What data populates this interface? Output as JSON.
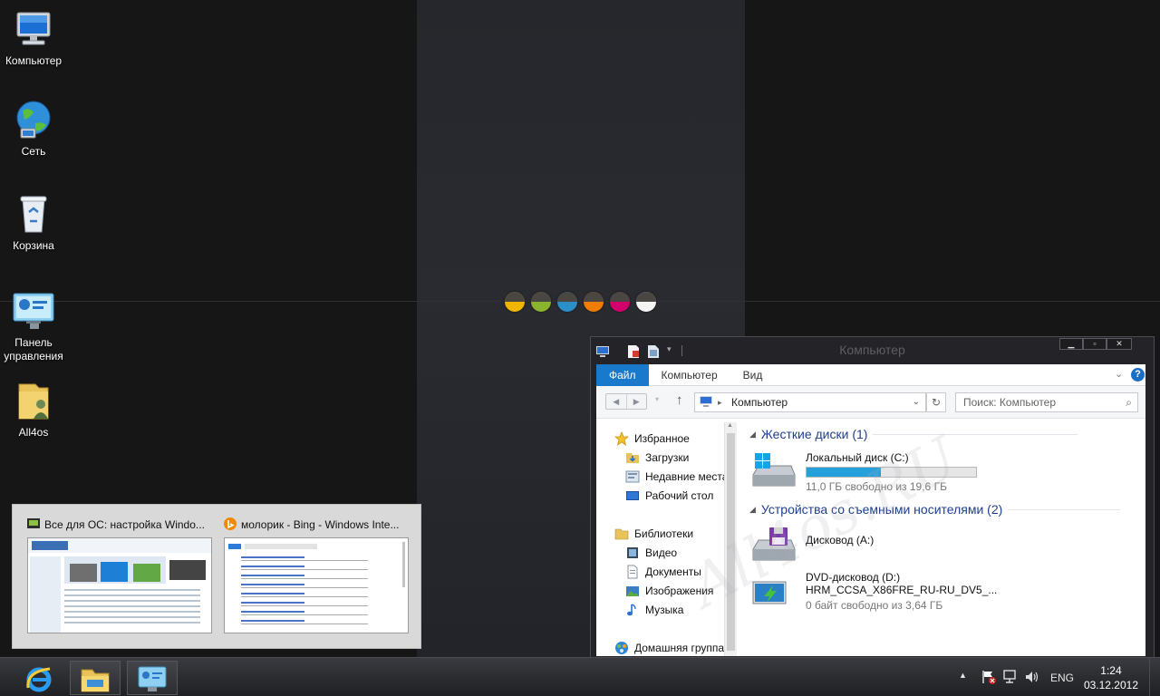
{
  "desktop": {
    "icons": [
      {
        "label": "Компьютер",
        "icon": "computer-icon"
      },
      {
        "label": "Сеть",
        "icon": "network-globe-icon"
      },
      {
        "label": "Корзина",
        "icon": "recycle-bin-icon"
      },
      {
        "label": "Панель управления",
        "icon": "control-panel-icon"
      },
      {
        "label": "All4os",
        "icon": "user-folder-icon"
      }
    ],
    "color_dots": [
      "#f3b600",
      "#8ab32e",
      "#2c8fc9",
      "#f07c00",
      "#d4006b",
      "#f4f4f4"
    ]
  },
  "preview": {
    "items": [
      {
        "title": "Все для ОС: настройка Windo...",
        "icon": "ie-page-icon"
      },
      {
        "title": "молорик - Bing - Windows Inte...",
        "icon": "bing-icon"
      }
    ]
  },
  "explorer": {
    "title": "Компьютер",
    "tabs": [
      "Файл",
      "Компьютер",
      "Вид"
    ],
    "address": "Компьютер",
    "search_placeholder": "Поиск: Компьютер",
    "nav": {
      "favorites": "Избранное",
      "downloads": "Загрузки",
      "recent": "Недавние места",
      "desktop": "Рабочий стол",
      "libraries": "Библиотеки",
      "video": "Видео",
      "documents": "Документы",
      "images": "Изображения",
      "music": "Музыка",
      "homegroup": "Домашняя группа"
    },
    "groups": {
      "hard_disks": "Жесткие диски (1)",
      "removable": "Устройства со съемными носителями (2)"
    },
    "drives": {
      "c": {
        "name": "Локальный диск (C:)",
        "free": "11,0 ГБ свободно из 19,6 ГБ",
        "used_fraction": 0.44
      },
      "a": {
        "name": "Дисковод (A:)"
      },
      "d": {
        "name": "DVD-дисковод (D:)",
        "label": "HRM_CCSA_X86FRE_RU-RU_DV5_...",
        "free": "0 байт свободно из 3,64 ГБ"
      }
    },
    "watermark": "All4os.RU"
  },
  "taskbar": {
    "language": "ENG",
    "time": "1:24",
    "date": "03.12.2012"
  }
}
